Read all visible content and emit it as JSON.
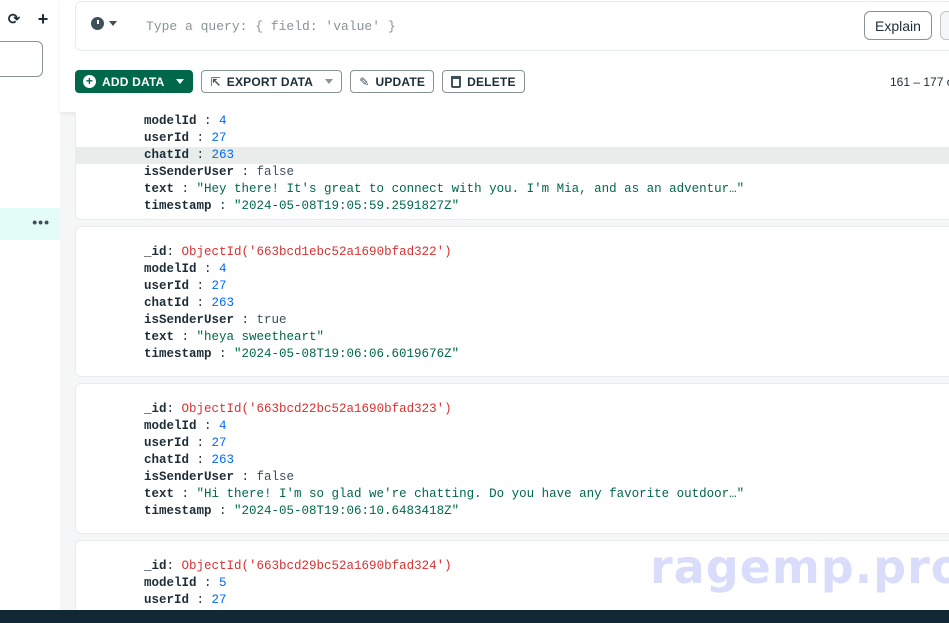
{
  "sidebar": {
    "refresh_icon": "refresh-icon",
    "plus_icon": "plus-icon",
    "more_icon": "ellipsis-icon",
    "more_glyph": "•••"
  },
  "query": {
    "placeholder": "Type a query: { field: 'value' }",
    "value": "",
    "history_icon": "clock-icon",
    "explain_label": "Explain"
  },
  "toolbar": {
    "add_data": "ADD DATA",
    "export_data": "EXPORT DATA",
    "update": "UPDATE",
    "delete": "DELETE",
    "pagination": "161 – 177 o"
  },
  "documents": [
    {
      "fields": [
        {
          "key": "modelId",
          "value": "4",
          "type": "num"
        },
        {
          "key": "userId",
          "value": "27",
          "type": "num"
        },
        {
          "key": "chatId",
          "value": "263",
          "type": "num"
        },
        {
          "key": "isSenderUser",
          "value": "false",
          "type": "bool"
        },
        {
          "key": "text",
          "value": "\"Hey there! It's great to connect with you. I'm Mia, and as an adventur…\"",
          "type": "str"
        },
        {
          "key": "timestamp",
          "value": "\"2024-05-08T19:05:59.2591827Z\"",
          "type": "str"
        }
      ]
    },
    {
      "fields": [
        {
          "key": "_id",
          "value": "ObjectId('663bcd1ebc52a1690bfad322')",
          "type": "oid"
        },
        {
          "key": "modelId",
          "value": "4",
          "type": "num"
        },
        {
          "key": "userId",
          "value": "27",
          "type": "num"
        },
        {
          "key": "chatId",
          "value": "263",
          "type": "num"
        },
        {
          "key": "isSenderUser",
          "value": "true",
          "type": "bool"
        },
        {
          "key": "text",
          "value": "\"heya sweetheart\"",
          "type": "str"
        },
        {
          "key": "timestamp",
          "value": "\"2024-05-08T19:06:06.6019676Z\"",
          "type": "str"
        }
      ]
    },
    {
      "fields": [
        {
          "key": "_id",
          "value": "ObjectId('663bcd22bc52a1690bfad323')",
          "type": "oid"
        },
        {
          "key": "modelId",
          "value": "4",
          "type": "num"
        },
        {
          "key": "userId",
          "value": "27",
          "type": "num"
        },
        {
          "key": "chatId",
          "value": "263",
          "type": "num"
        },
        {
          "key": "isSenderUser",
          "value": "false",
          "type": "bool"
        },
        {
          "key": "text",
          "value": "\"Hi there! I'm so glad we're chatting. Do you have any favorite outdoor…\"",
          "type": "str"
        },
        {
          "key": "timestamp",
          "value": "\"2024-05-08T19:06:10.6483418Z\"",
          "type": "str"
        }
      ]
    },
    {
      "fields": [
        {
          "key": "_id",
          "value": "ObjectId('663bcd29bc52a1690bfad324')",
          "type": "oid"
        },
        {
          "key": "modelId",
          "value": "5",
          "type": "num"
        },
        {
          "key": "userId",
          "value": "27",
          "type": "num"
        }
      ]
    }
  ],
  "watermark": "ragemp.pro",
  "colors": {
    "primary_green": "#00684a",
    "objectid_red": "#db3030",
    "number_blue": "#016bf8",
    "string_green": "#00684a",
    "highlight_row": "#e8edeb",
    "selected_sidebar": "#e3fcf7",
    "bottom_bar": "#112733"
  }
}
